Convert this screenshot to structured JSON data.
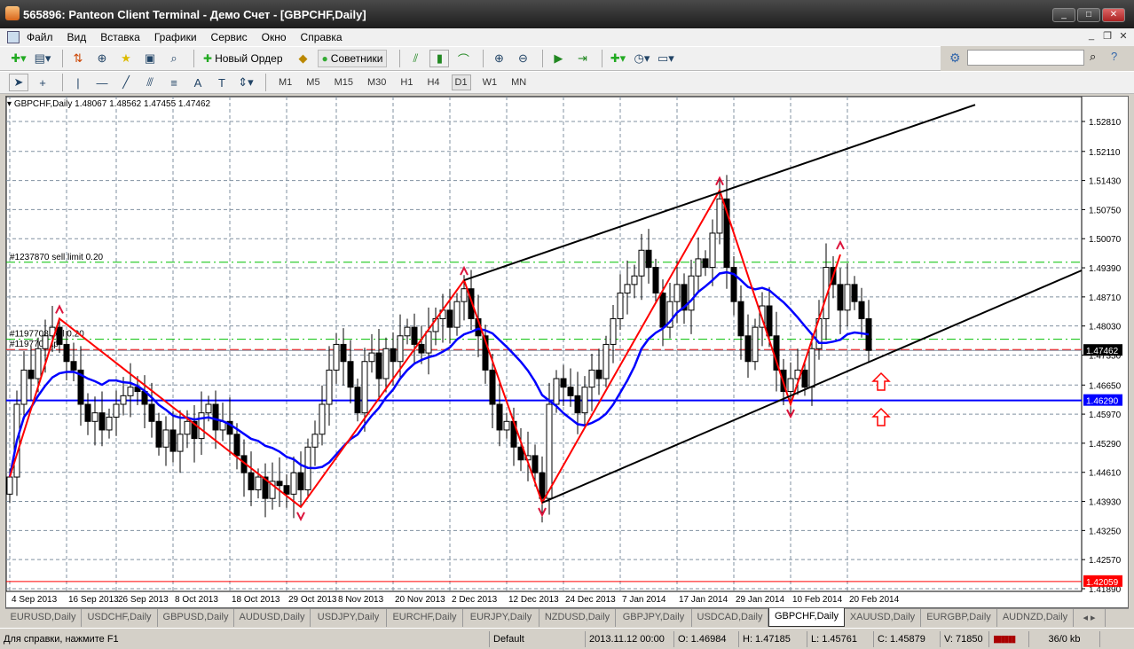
{
  "window": {
    "title": "565896: Panteon Client Terminal - Демо Счет - [GBPCHF,Daily]",
    "min": "_",
    "max": "□",
    "close": "✕"
  },
  "menu": [
    "Файл",
    "Вид",
    "Вставка",
    "Графики",
    "Сервис",
    "Окно",
    "Справка"
  ],
  "toolbar": {
    "new_order": "Новый Ордер",
    "experts": "Советники"
  },
  "timeframes": [
    "M1",
    "M5",
    "M15",
    "M30",
    "H1",
    "H4",
    "D1",
    "W1",
    "MN"
  ],
  "active_timeframe": "D1",
  "chart": {
    "header": "GBPCHF,Daily  1.48067 1.48562 1.47455 1.47462",
    "order_labels": [
      "#1237870 sell limit 0.20",
      "#1197708 sell 0.20",
      "#1197708 tp"
    ],
    "current_price": "1.47462",
    "level_price": "1.46290",
    "sl_price": "1.42059"
  },
  "chart_data": {
    "type": "candlestick",
    "symbol": "GBPCHF",
    "timeframe": "Daily",
    "y_ticks": [
      "1.52810",
      "1.52110",
      "1.51430",
      "1.50750",
      "1.50070",
      "1.49390",
      "1.48710",
      "1.48030",
      "1.47350",
      "1.46650",
      "1.45970",
      "1.45290",
      "1.44610",
      "1.43930",
      "1.43250",
      "1.42570",
      "1.41890"
    ],
    "x_ticks": [
      "4 Sep 2013",
      "16 Sep 2013",
      "26 Sep 2013",
      "8 Oct 2013",
      "18 Oct 2013",
      "29 Oct 2013",
      "8 Nov 2013",
      "20 Nov 2013",
      "2 Dec 2013",
      "12 Dec 2013",
      "24 Dec 2013",
      "7 Jan 2014",
      "17 Jan 2014",
      "29 Jan 2014",
      "10 Feb 2014",
      "20 Feb 2014"
    ],
    "ylim": [
      1.4189,
      1.5281
    ],
    "closes": [
      1.445,
      1.462,
      1.47,
      1.468,
      1.475,
      1.478,
      1.48,
      1.476,
      1.472,
      1.47,
      1.462,
      1.458,
      1.46,
      1.456,
      1.459,
      1.462,
      1.464,
      1.466,
      1.465,
      1.462,
      1.458,
      1.452,
      1.456,
      1.451,
      1.455,
      1.458,
      1.454,
      1.46,
      1.462,
      1.456,
      1.458,
      1.455,
      1.45,
      1.446,
      1.442,
      1.445,
      1.44,
      1.444,
      1.443,
      1.441,
      1.446,
      1.442,
      1.452,
      1.455,
      1.462,
      1.47,
      1.476,
      1.472,
      1.466,
      1.46,
      1.472,
      1.474,
      1.468,
      1.475,
      1.472,
      1.478,
      1.48,
      1.476,
      1.474,
      1.479,
      1.482,
      1.484,
      1.48,
      1.486,
      1.489,
      1.482,
      1.478,
      1.47,
      1.462,
      1.456,
      1.458,
      1.452,
      1.449,
      1.45,
      1.446,
      1.44,
      1.462,
      1.468,
      1.466,
      1.464,
      1.46,
      1.466,
      1.47,
      1.468,
      1.476,
      1.482,
      1.488,
      1.49,
      1.492,
      1.498,
      1.494,
      1.488,
      1.48,
      1.486,
      1.49,
      1.484,
      1.492,
      1.496,
      1.494,
      1.502,
      1.51,
      1.494,
      1.486,
      1.478,
      1.472,
      1.48,
      1.485,
      1.478,
      1.47,
      1.465,
      1.468,
      1.47,
      1.466,
      1.475,
      1.482,
      1.494,
      1.49,
      1.484,
      1.49,
      1.486,
      1.482,
      1.4746
    ],
    "zigzag": [
      [
        0,
        1.445
      ],
      [
        7,
        1.482
      ],
      [
        41,
        1.438
      ],
      [
        64,
        1.491
      ],
      [
        75,
        1.439
      ],
      [
        100,
        1.512
      ],
      [
        110,
        1.462
      ],
      [
        117,
        1.497
      ]
    ],
    "channel_upper": [
      [
        64,
        1.491
      ],
      [
        136,
        1.532
      ]
    ],
    "channel_lower": [
      [
        75,
        1.439
      ],
      [
        152,
        1.494
      ]
    ],
    "levels": {
      "sell_limit": 1.4952,
      "sell": 1.4772,
      "tp": 1.4748,
      "support": 1.4629,
      "sl": 1.42059
    },
    "colors": {
      "zigzag": "#ff0000",
      "ma": "#0000ff",
      "channel": "#000000",
      "support": "#0000ff",
      "order": "#00c000"
    }
  },
  "tabs": [
    "EURUSD,Daily",
    "USDCHF,Daily",
    "GBPUSD,Daily",
    "AUDUSD,Daily",
    "USDJPY,Daily",
    "EURCHF,Daily",
    "EURJPY,Daily",
    "NZDUSD,Daily",
    "GBPJPY,Daily",
    "USDCAD,Daily",
    "GBPCHF,Daily",
    "XAUUSD,Daily",
    "EURGBP,Daily",
    "AUDNZD,Daily"
  ],
  "active_tab": "GBPCHF,Daily",
  "status": {
    "help": "Для справки, нажмите F1",
    "profile": "Default",
    "time": "2013.11.12 00:00",
    "open": "O: 1.46984",
    "high": "H: 1.47185",
    "low": "L: 1.45761",
    "close": "C: 1.45879",
    "volume": "V: 71850",
    "traffic": "36/0 kb"
  }
}
